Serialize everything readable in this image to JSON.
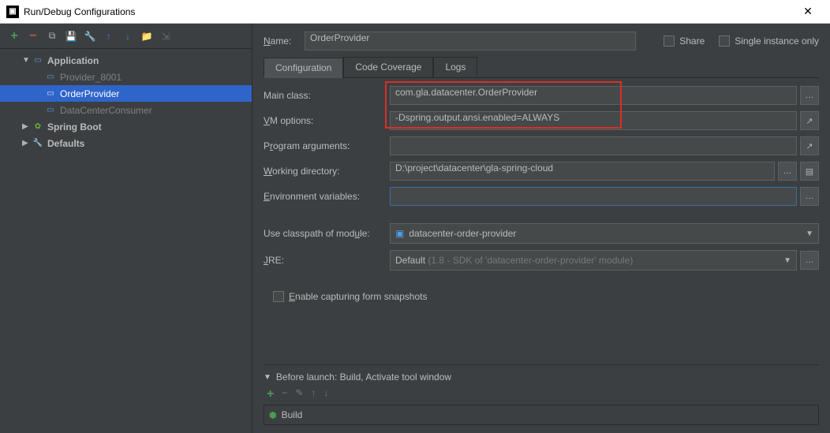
{
  "window": {
    "title": "Run/Debug Configurations"
  },
  "toolbar": {
    "icons": [
      "plus-icon",
      "minus-icon",
      "copy-icon",
      "save-icon",
      "wrench-icon",
      "arrow-up-icon",
      "arrow-down-icon",
      "folder-icon",
      "collapse-icon"
    ]
  },
  "tree": {
    "nodes": [
      {
        "label": "Application",
        "expanded": true,
        "icon": "app"
      },
      {
        "label": "Provider_8001",
        "lvl": 2
      },
      {
        "label": "OrderProvider",
        "lvl": 2,
        "selected": true
      },
      {
        "label": "DataCenterConsumer",
        "lvl": 2
      },
      {
        "label": "Spring Boot",
        "expanded": false,
        "icon": "spring"
      },
      {
        "label": "Defaults",
        "expanded": false,
        "icon": "wrench"
      }
    ]
  },
  "header": {
    "name_label": "Name:",
    "name_value": "OrderProvider",
    "share_label": "Share",
    "single_label": "Single instance only"
  },
  "tabs": [
    "Configuration",
    "Code Coverage",
    "Logs"
  ],
  "form": {
    "main_class_label": "Main class:",
    "main_class_value": "com.gla.datacenter.OrderProvider",
    "vm_label": "VM options:",
    "vm_value": "-Dspring.output.ansi.enabled=ALWAYS",
    "args_label": "Program arguments:",
    "args_value": "",
    "wd_label": "Working directory:",
    "wd_value": "D:\\project\\datacenter\\gla-spring-cloud",
    "env_label": "Environment variables:",
    "env_value": "",
    "cp_label": "Use classpath of module:",
    "cp_value": "datacenter-order-provider",
    "jre_label": "JRE:",
    "jre_prefix": "Default ",
    "jre_dim": "(1.8 - SDK of 'datacenter-order-provider' module)",
    "enable_snapshot_label": "Enable capturing form snapshots"
  },
  "before_launch": {
    "header": "Before launch: Build, Activate tool window",
    "item": "Build"
  }
}
